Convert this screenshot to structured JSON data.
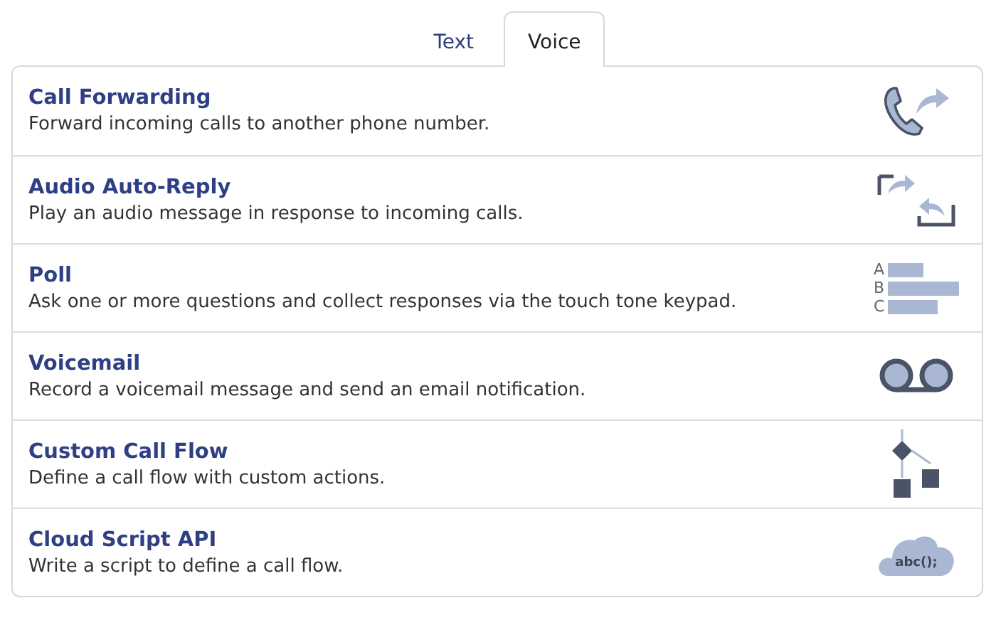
{
  "tabs": [
    {
      "label": "Text",
      "selected": false
    },
    {
      "label": "Voice",
      "selected": true
    }
  ],
  "items": [
    {
      "kind": "forward",
      "title": "Call Forwarding",
      "description": "Forward incoming calls to another phone number."
    },
    {
      "kind": "auto-reply",
      "title": "Audio Auto-Reply",
      "description": "Play an audio message in response to incoming calls."
    },
    {
      "kind": "poll",
      "title": "Poll",
      "description": "Ask one or more questions and collect responses via the touch tone keypad.",
      "icon_text": [
        "A",
        "B",
        "C"
      ]
    },
    {
      "kind": "voicemail",
      "title": "Voicemail",
      "description": "Record a voicemail message and send an email notification."
    },
    {
      "kind": "flow",
      "title": "Custom Call Flow",
      "description": "Define a call flow with custom actions."
    },
    {
      "kind": "cloud",
      "title": "Cloud Script API",
      "description": "Write a script to define a call flow.",
      "icon_text": [
        "abc();"
      ]
    }
  ]
}
